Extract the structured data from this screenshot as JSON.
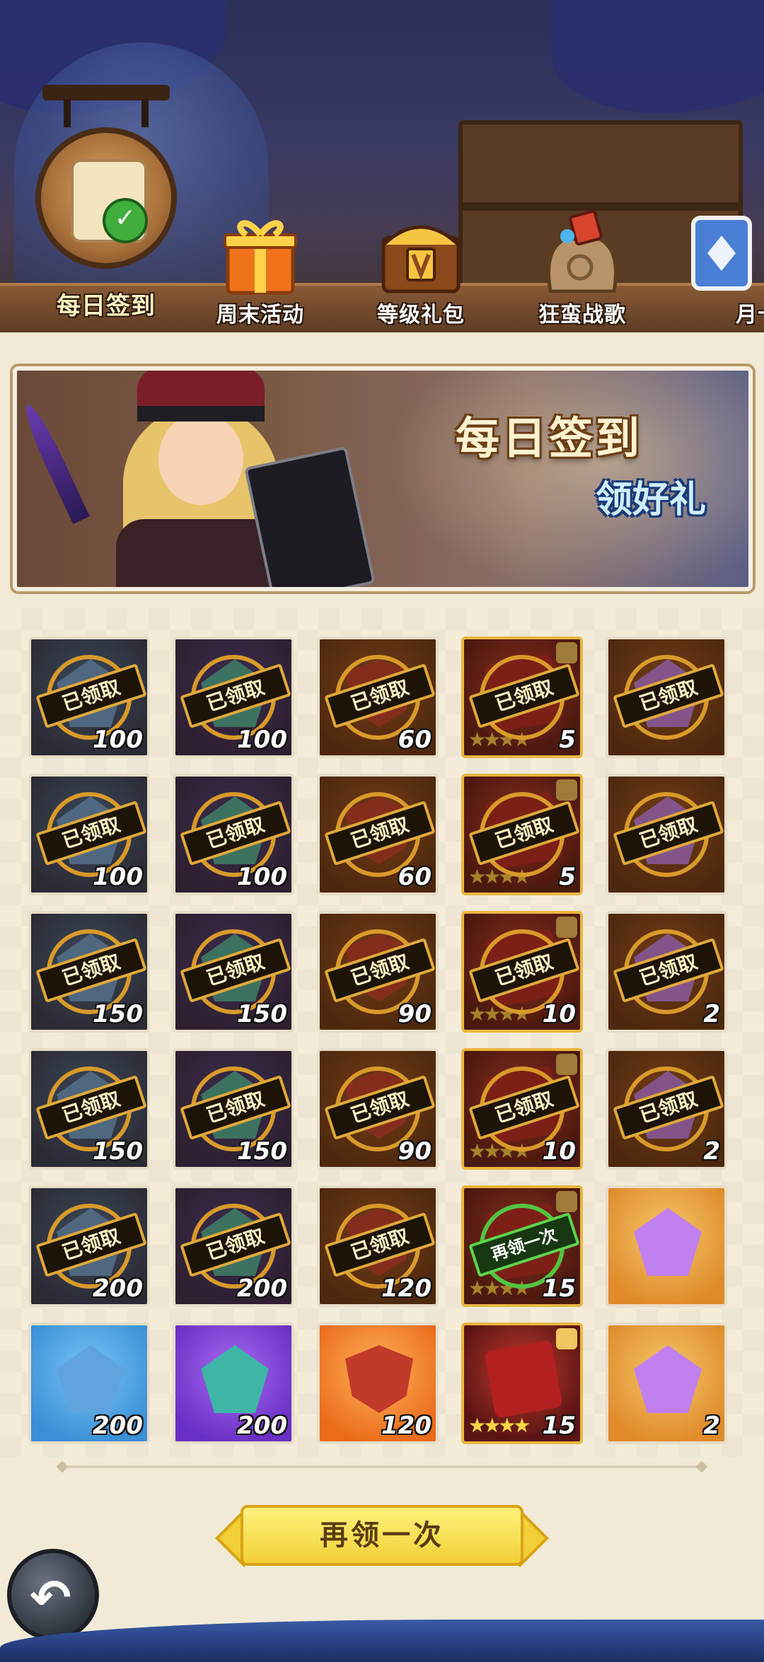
{
  "tabs": [
    {
      "label": "每日签到",
      "icon": "scroll-check-icon"
    },
    {
      "label": "周末活动",
      "icon": "gift-box-icon"
    },
    {
      "label": "等级礼包",
      "icon": "treasure-chest-icon"
    },
    {
      "label": "狂蛮战歌",
      "icon": "loot-bag-icon"
    },
    {
      "label": "月卡",
      "icon": "card-icon"
    }
  ],
  "banner": {
    "title": "每日签到",
    "subtitle": "领好礼"
  },
  "rewards": {
    "claimed_label": "已领取",
    "reclaim_label": "再领一次",
    "rows": [
      [
        "100",
        "100",
        "60",
        "5",
        ""
      ],
      [
        "100",
        "100",
        "60",
        "5",
        ""
      ],
      [
        "150",
        "150",
        "90",
        "10",
        "2"
      ],
      [
        "150",
        "150",
        "90",
        "10",
        "2"
      ],
      [
        "200",
        "200",
        "120",
        "15",
        ""
      ],
      [
        "200",
        "200",
        "120",
        "15",
        "2"
      ]
    ]
  },
  "reclaim_button": "再领一次",
  "colors": {
    "accent_gold": "#f2cf36",
    "claimed_border": "#e0a93a",
    "reclaim_green": "#5dd44c"
  }
}
